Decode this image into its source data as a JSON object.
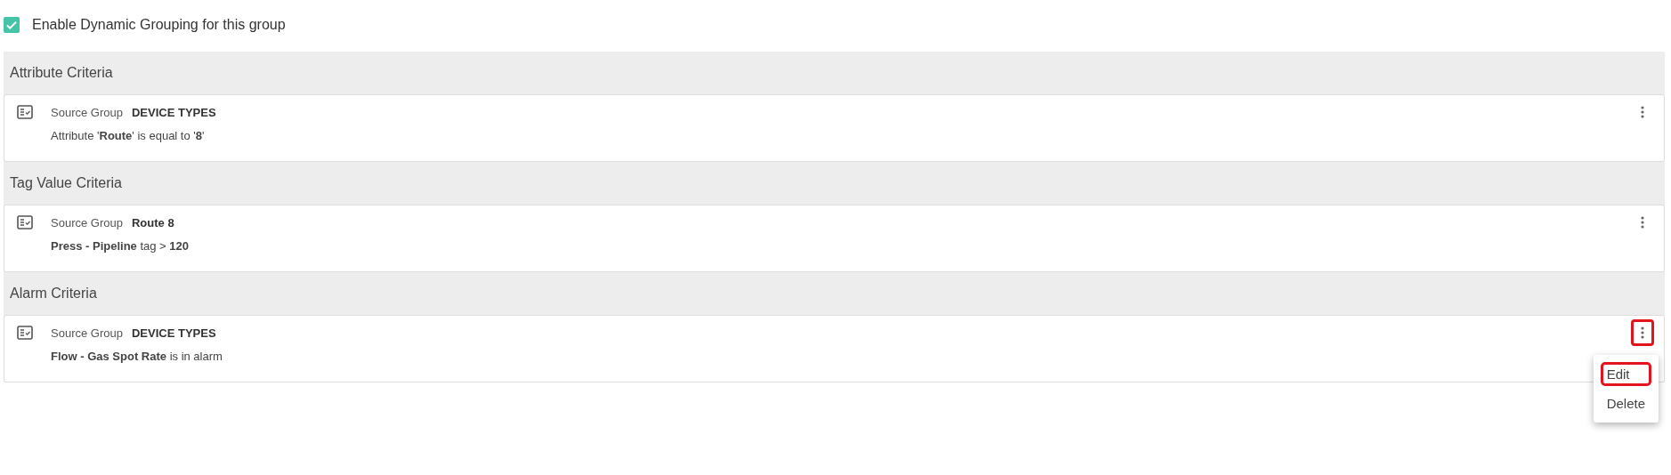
{
  "enable_dynamic_grouping": {
    "label": "Enable Dynamic Grouping for this group",
    "checked": true
  },
  "sections": [
    {
      "title": "Attribute Criteria",
      "criteria": [
        {
          "source_label": "Source Group",
          "source_group": "DEVICE TYPES",
          "description": "Attribute '**Route**' is equal to '**8**'",
          "menu_highlighted": false
        }
      ]
    },
    {
      "title": "Tag Value Criteria",
      "criteria": [
        {
          "source_label": "Source Group",
          "source_group": "Route 8",
          "description": "**Press - Pipeline** tag > **120**",
          "menu_highlighted": false
        }
      ]
    },
    {
      "title": "Alarm Criteria",
      "criteria": [
        {
          "source_label": "Source Group",
          "source_group": "DEVICE TYPES",
          "description": "**Flow - Gas Spot Rate** is in alarm",
          "menu_highlighted": true,
          "menu": [
            {
              "label": "Edit",
              "highlighted": true
            },
            {
              "label": "Delete",
              "highlighted": false
            }
          ]
        }
      ]
    }
  ]
}
